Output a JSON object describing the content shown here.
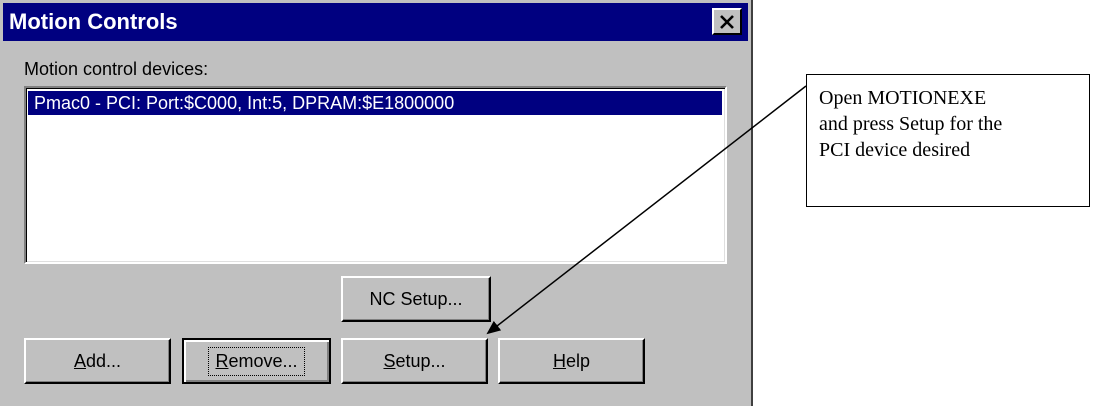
{
  "window": {
    "title": "Motion Controls",
    "close_icon": "close-x-icon"
  },
  "devices": {
    "label": "Motion control devices:",
    "items": [
      "Pmac0 - PCI: Port:$C000, Int:5, DPRAM:$E1800000"
    ],
    "selected_index": 0
  },
  "buttons": {
    "nc_setup": "NC Setup...",
    "add": {
      "mnemonic": "A",
      "rest": "dd..."
    },
    "remove": {
      "mnemonic": "R",
      "rest": "emove..."
    },
    "setup": {
      "mnemonic": "S",
      "rest": "etup..."
    },
    "help": {
      "mnemonic": "H",
      "rest": "elp"
    }
  },
  "callout": {
    "lines": [
      "Open MOTIONEXE",
      "and press Setup for the",
      "PCI device desired"
    ]
  },
  "colors": {
    "titlebar": "#000080",
    "face": "#c0c0c0",
    "selection": "#000080"
  }
}
